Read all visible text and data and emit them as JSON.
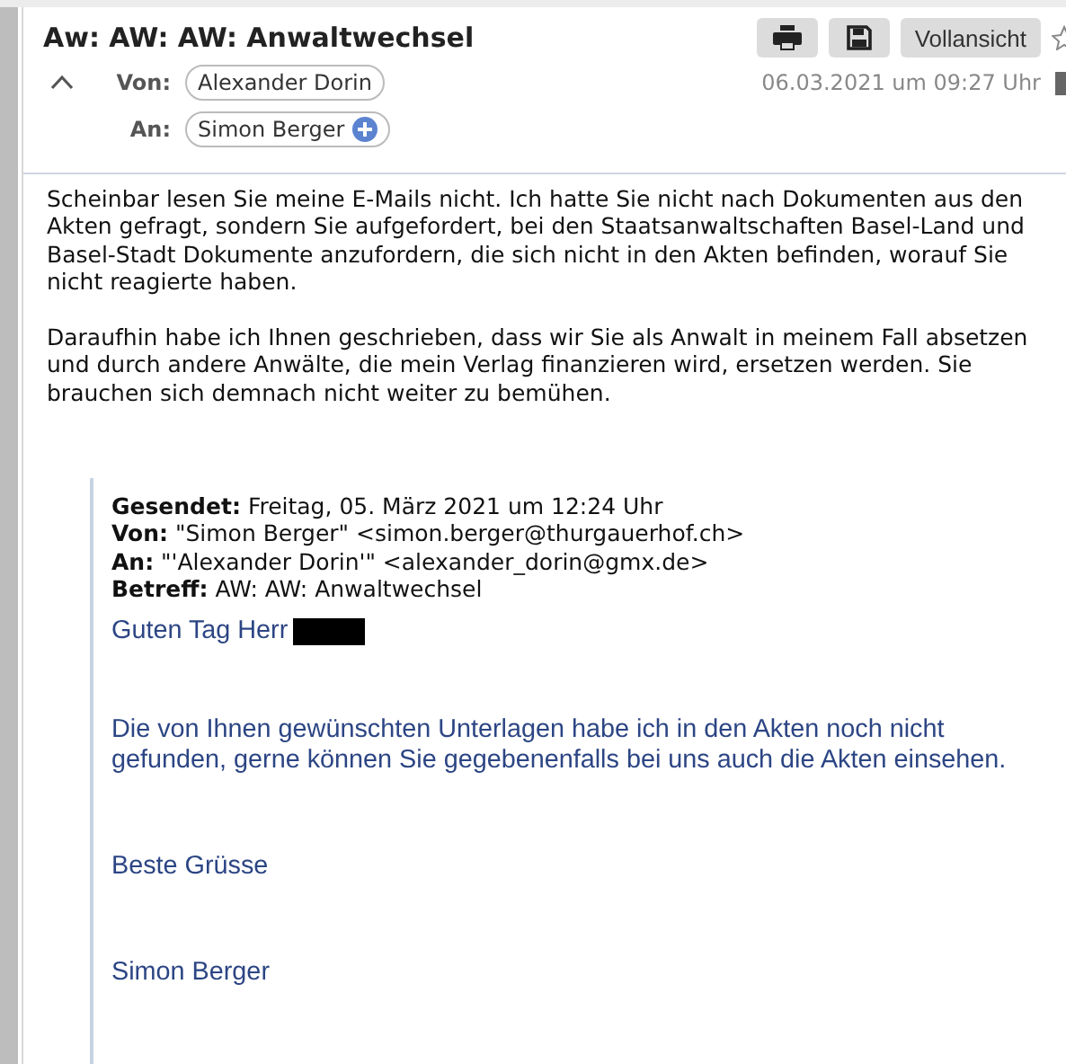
{
  "message": {
    "subject": "Aw: AW: AW: Anwaltwechsel",
    "actions": [
      {
        "kind": "print"
      },
      {
        "kind": "save"
      },
      {
        "kind": "text",
        "label": "Vollansicht"
      }
    ],
    "starred": false,
    "header_expanded": true,
    "from": {
      "label": "Von:",
      "contacts": [
        {
          "name": "Alexander Dorin",
          "addable": false
        }
      ]
    },
    "to": {
      "label": "An:",
      "contacts": [
        {
          "name": "Simon Berger",
          "addable": true
        }
      ]
    },
    "date": "06.03.2021 um 09:27 Uhr"
  },
  "body": {
    "paragraphs": [
      "Scheinbar lesen Sie meine E-Mails nicht. Ich hatte Sie nicht nach Dokumenten aus den Akten gefragt, sondern Sie aufgefordert, bei den Staatsanwaltschaften Basel-Land und Basel-Stadt Dokumente anzufordern, die sich nicht in den Akten befinden, worauf Sie nicht reagierte haben.",
      "Daraufhin habe ich Ihnen geschrieben, dass wir Sie als Anwalt in meinem Fall absetzen und durch andere Anwälte, die mein Verlag finanzieren wird, ersetzen werden. Sie brauchen sich demnach nicht weiter zu bemühen."
    ],
    "quote": {
      "headers": [
        "**Gesendet:** Freitag, 05. März 2021 um 12:24 Uhr",
        "**Von:** \"Simon Berger\" <simon.berger@thurgauerhof.ch>",
        "**An:** \"'Alexander Dorin'\" <alexander_dorin@gmx.de>",
        "**Betreff:** AW: AW: Anwaltwechsel"
      ],
      "paragraphs": [
        {
          "text": "Guten Tag Herr",
          "redacted": true
        },
        {
          "text": "Die von Ihnen gewünschten Unterlagen habe ich in den Akten noch nicht gefunden, gerne können Sie gegebenenfalls bei uns auch die Akten einsehen.",
          "redacted": false
        },
        {
          "text": "Beste Grüsse",
          "redacted": false
        },
        {
          "text": "Simon Berger",
          "redacted": false
        }
      ]
    }
  }
}
